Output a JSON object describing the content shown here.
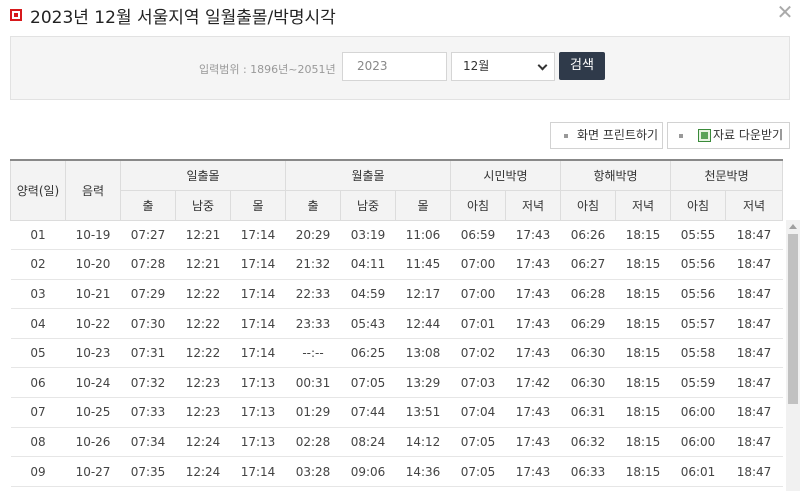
{
  "title": "2023년 12월 서울지역 일월출몰/박명시각",
  "close_icon": "close-icon",
  "search": {
    "range_label": "입력범위 : 1896년~2051년",
    "year_placeholder": "2023",
    "month_selected": "12월",
    "button": "검색"
  },
  "toolbar": {
    "print_label": "화면 프린트하기",
    "download_label": "자료 다운받기"
  },
  "table": {
    "headers": {
      "solar_date": "양력(일)",
      "lunar_date": "음력",
      "sun": "일출몰",
      "moon": "월출몰",
      "civil": "시민박명",
      "nautical": "항해박명",
      "astro": "천문박명",
      "rise": "출",
      "transit": "남중",
      "set": "몰",
      "morning": "아침",
      "evening": "저녁"
    },
    "rows": [
      [
        "01",
        "10-19",
        "07:27",
        "12:21",
        "17:14",
        "20:29",
        "03:19",
        "11:06",
        "06:59",
        "17:43",
        "06:26",
        "18:15",
        "05:55",
        "18:47"
      ],
      [
        "02",
        "10-20",
        "07:28",
        "12:21",
        "17:14",
        "21:32",
        "04:11",
        "11:45",
        "07:00",
        "17:43",
        "06:27",
        "18:15",
        "05:56",
        "18:47"
      ],
      [
        "03",
        "10-21",
        "07:29",
        "12:22",
        "17:14",
        "22:33",
        "04:59",
        "12:17",
        "07:00",
        "17:43",
        "06:28",
        "18:15",
        "05:56",
        "18:47"
      ],
      [
        "04",
        "10-22",
        "07:30",
        "12:22",
        "17:14",
        "23:33",
        "05:43",
        "12:44",
        "07:01",
        "17:43",
        "06:29",
        "18:15",
        "05:57",
        "18:47"
      ],
      [
        "05",
        "10-23",
        "07:31",
        "12:22",
        "17:14",
        "--:--",
        "06:25",
        "13:08",
        "07:02",
        "17:43",
        "06:30",
        "18:15",
        "05:58",
        "18:47"
      ],
      [
        "06",
        "10-24",
        "07:32",
        "12:23",
        "17:13",
        "00:31",
        "07:05",
        "13:29",
        "07:03",
        "17:42",
        "06:30",
        "18:15",
        "05:59",
        "18:47"
      ],
      [
        "07",
        "10-25",
        "07:33",
        "12:23",
        "17:13",
        "01:29",
        "07:44",
        "13:51",
        "07:04",
        "17:43",
        "06:31",
        "18:15",
        "06:00",
        "18:47"
      ],
      [
        "08",
        "10-26",
        "07:34",
        "12:24",
        "17:13",
        "02:28",
        "08:24",
        "14:12",
        "07:05",
        "17:43",
        "06:32",
        "18:15",
        "06:00",
        "18:47"
      ],
      [
        "09",
        "10-27",
        "07:35",
        "12:24",
        "17:14",
        "03:28",
        "09:06",
        "14:36",
        "07:05",
        "17:43",
        "06:33",
        "18:15",
        "06:01",
        "18:47"
      ]
    ]
  }
}
